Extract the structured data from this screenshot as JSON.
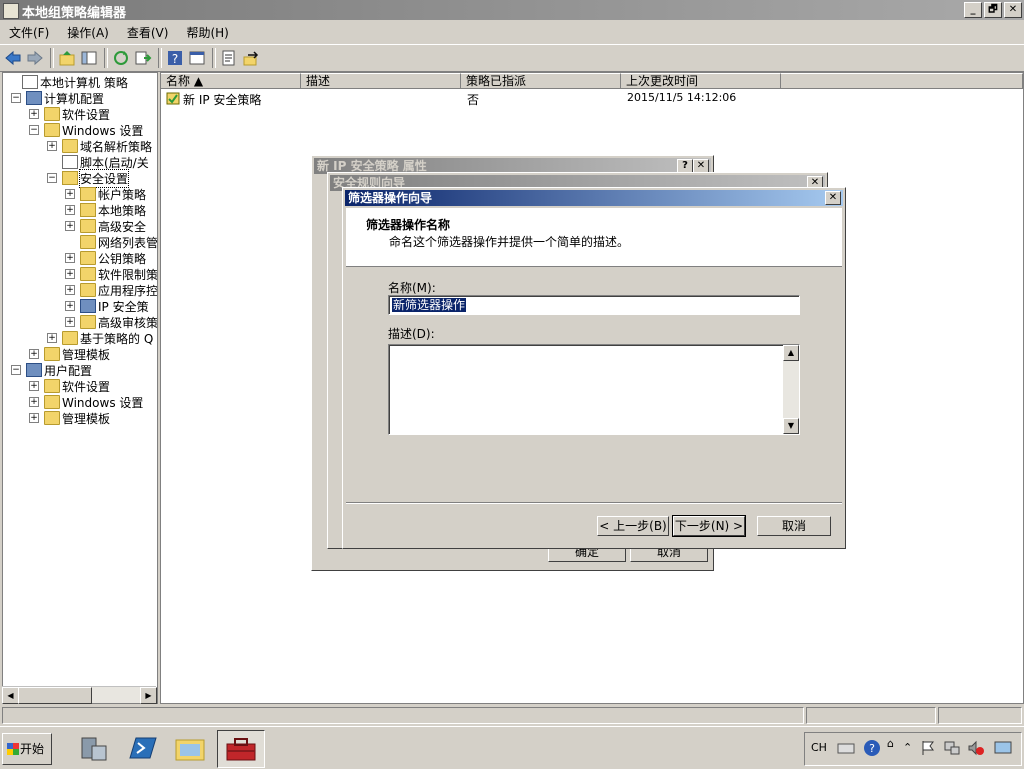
{
  "window": {
    "title": "本地组策略编辑器",
    "min": "_",
    "restore": "🗗",
    "close": "✕"
  },
  "menu": [
    "文件(F)",
    "操作(A)",
    "查看(V)",
    "帮助(H)"
  ],
  "tree": [
    {
      "label": "本地计算机 策略",
      "level": 0,
      "exp": "",
      "icon": "doc"
    },
    {
      "label": "计算机配置",
      "level": 1,
      "exp": "⊟",
      "icon": "pc"
    },
    {
      "label": "软件设置",
      "level": 2,
      "exp": "⊞",
      "icon": "folder"
    },
    {
      "label": "Windows 设置",
      "level": 2,
      "exp": "⊟",
      "icon": "folder"
    },
    {
      "label": "域名解析策略",
      "level": 3,
      "exp": "⊞",
      "icon": "folder"
    },
    {
      "label": "脚本(启动/关",
      "level": 3,
      "exp": "",
      "icon": "doc"
    },
    {
      "label": "安全设置",
      "level": 3,
      "exp": "⊟",
      "icon": "lockicon"
    },
    {
      "label": "帐户策略",
      "level": 4,
      "exp": "⊞",
      "icon": "lockicon"
    },
    {
      "label": "本地策略",
      "level": 4,
      "exp": "⊞",
      "icon": "lockicon"
    },
    {
      "label": "高级安全",
      "level": 4,
      "exp": "⊞",
      "icon": "folder"
    },
    {
      "label": "网络列表管",
      "level": 4,
      "exp": "",
      "icon": "folder"
    },
    {
      "label": "公钥策略",
      "level": 4,
      "exp": "⊞",
      "icon": "folder"
    },
    {
      "label": "软件限制策",
      "level": 4,
      "exp": "⊞",
      "icon": "folder"
    },
    {
      "label": "应用程序控",
      "level": 4,
      "exp": "⊞",
      "icon": "folder"
    },
    {
      "label": "IP 安全策",
      "level": 4,
      "exp": "⊞",
      "icon": "pc"
    },
    {
      "label": "高级审核策",
      "level": 4,
      "exp": "⊞",
      "icon": "folder"
    },
    {
      "label": "基于策略的 Q",
      "level": 3,
      "exp": "⊞",
      "icon": "folder"
    },
    {
      "label": "管理模板",
      "level": 2,
      "exp": "⊞",
      "icon": "folder"
    },
    {
      "label": "用户配置",
      "level": 1,
      "exp": "⊟",
      "icon": "pc"
    },
    {
      "label": "软件设置",
      "level": 2,
      "exp": "⊞",
      "icon": "folder"
    },
    {
      "label": "Windows 设置",
      "level": 2,
      "exp": "⊞",
      "icon": "folder"
    },
    {
      "label": "管理模板",
      "level": 2,
      "exp": "⊞",
      "icon": "folder"
    }
  ],
  "list": {
    "columns": [
      "名称 ▲",
      "描述",
      "策略已指派",
      "上次更改时间"
    ],
    "rows": [
      {
        "name": "新 IP 安全策略",
        "desc": "",
        "assigned": "否",
        "modified": "2015/11/5 14:12:06"
      }
    ]
  },
  "dialog_props": {
    "title": "新 IP 安全策略 属性",
    "help": "?",
    "close": "✕",
    "ok": "确定",
    "cancel": "取消"
  },
  "dialog_rule_wizard": {
    "title": "安全规则向导",
    "close": "✕"
  },
  "wizard": {
    "title": "筛选器操作向导",
    "close": "✕",
    "header_title": "筛选器操作名称",
    "header_desc": "命名这个筛选器操作并提供一个简单的描述。",
    "name_label": "名称(M):",
    "name_value": "新筛选器操作",
    "desc_label": "描述(D):",
    "desc_value": "",
    "back": "< 上一步(B)",
    "next": "下一步(N) >",
    "cancel": "取消"
  },
  "taskbar": {
    "start": "开始",
    "lang": "CH"
  }
}
